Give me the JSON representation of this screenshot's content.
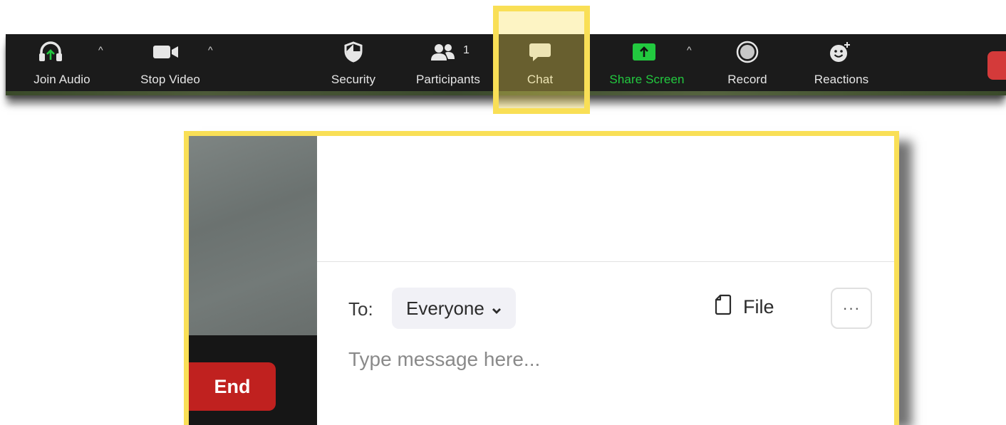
{
  "toolbar": {
    "join_audio": "Join Audio",
    "stop_video": "Stop Video",
    "security": "Security",
    "participants": "Participants",
    "participant_count": "1",
    "chat": "Chat",
    "share_screen": "Share Screen",
    "record": "Record",
    "reactions": "Reactions",
    "caret": "^"
  },
  "icons": {
    "audio": "headphones-icon",
    "video": "video-camera-icon",
    "security": "shield-icon",
    "participants": "people-icon",
    "chat": "speech-bubble-icon",
    "share": "share-screen-arrow-icon",
    "record": "record-circle-icon",
    "reactions": "emoji-add-icon",
    "file": "document-icon",
    "more": "ellipsis-icon"
  },
  "colors": {
    "toolbar_bg": "#1b1b1b",
    "share_green": "#22c93f",
    "highlight_yellow": "#f9df56",
    "end_red": "#c0211f"
  },
  "chat_panel": {
    "end_label": "End",
    "to_label": "To:",
    "recipient": "Everyone",
    "file_label": "File",
    "more_label": "···",
    "message_placeholder": "Type message here..."
  }
}
